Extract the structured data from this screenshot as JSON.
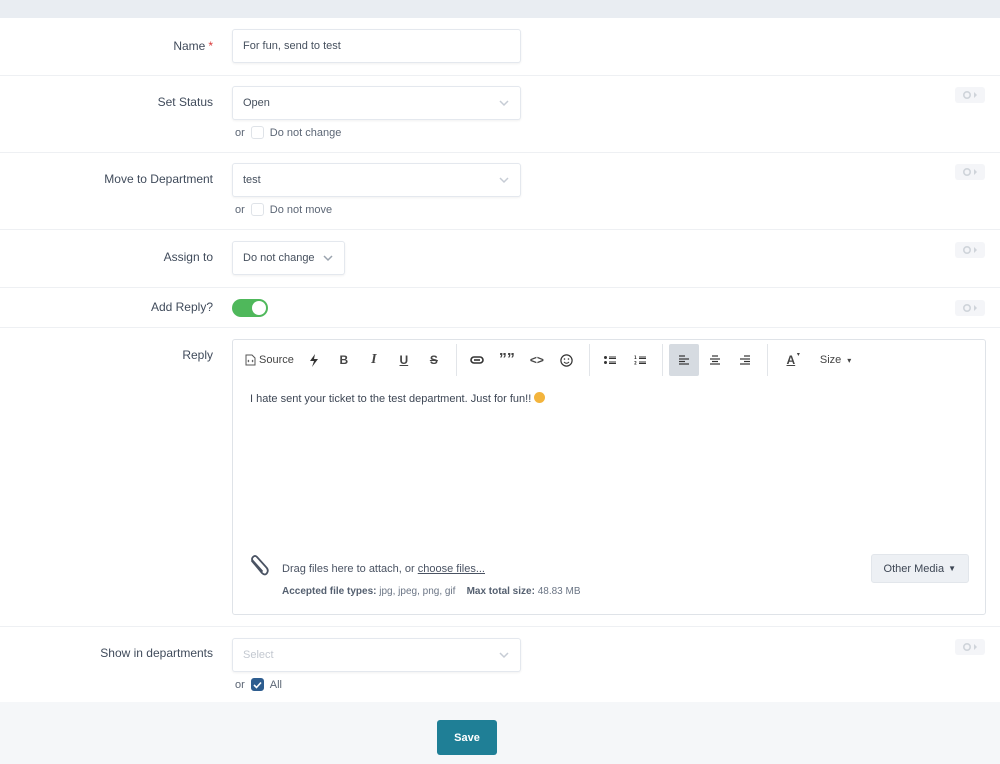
{
  "form": {
    "name": {
      "label": "Name",
      "required_mark": "*",
      "value": "For fun, send to test"
    },
    "set_status": {
      "label": "Set Status",
      "selected": "Open",
      "or_label": "or",
      "checkbox_label": "Do not change",
      "checkbox_checked": false
    },
    "move_to_department": {
      "label": "Move to Department",
      "selected": "test",
      "or_label": "or",
      "checkbox_label": "Do not move",
      "checkbox_checked": false
    },
    "assign_to": {
      "label": "Assign to",
      "selected": "Do not change"
    },
    "add_reply": {
      "label": "Add Reply?",
      "enabled": true
    },
    "reply": {
      "label": "Reply",
      "toolbar": {
        "source_label": "Source",
        "size_label": "Size",
        "bold": "B",
        "italic": "I",
        "underline": "U",
        "strike": "S",
        "quote": "”",
        "code": "<>",
        "text_color": "A"
      },
      "content": "I hate sent your ticket to the test department. Just for fun!!",
      "attach": {
        "drag_text": "Drag files here to attach, or ",
        "choose_link": "choose files...",
        "accepted_label": "Accepted file types:",
        "accepted_value": "jpg, jpeg, png, gif",
        "max_label": "Max total size:",
        "max_value": "48.83 MB"
      },
      "other_media_label": "Other Media"
    },
    "show_in_departments": {
      "label": "Show in departments",
      "placeholder": "Select",
      "or_label": "or",
      "checkbox_label": "All",
      "checkbox_checked": true
    }
  },
  "footer": {
    "save_label": "Save"
  },
  "colors": {
    "accent": "#1f7f96",
    "toggle_on": "#4fb85b",
    "checkbox_checked": "#2e5d8f",
    "required": "#d93a3a"
  }
}
